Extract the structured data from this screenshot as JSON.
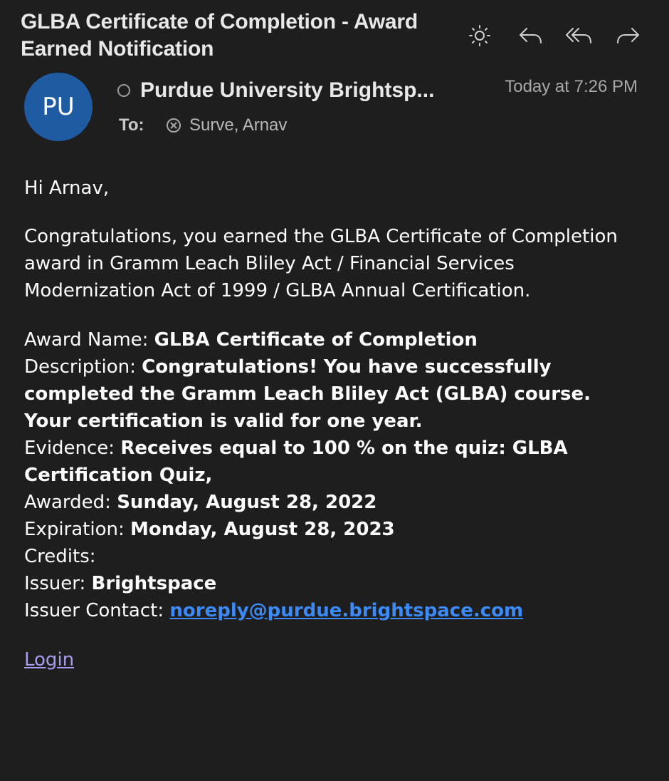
{
  "email": {
    "subject": "GLBA Certificate of Completion - Award Earned Notification",
    "avatar_initials": "PU",
    "sender": "Purdue University Brightsp...",
    "date": "Today at 7:26 PM",
    "to_label": "To:",
    "recipient": "Surve, Arnav"
  },
  "toolbar": {
    "icons": [
      "brightness-icon",
      "reply-icon",
      "reply-all-icon",
      "forward-icon"
    ]
  },
  "body": {
    "greeting": "Hi Arnav,",
    "para_lines": [
      "Congratulations, you earned the GLBA Certificate of Completion",
      "award in Gramm Leach Bliley Act / Financial Services",
      "Modernization Act of 1999 / GLBA Annual Certification."
    ],
    "award_name_label": "Award Name:",
    "award_name": "GLBA Certificate of Completion",
    "description_label": "Description:",
    "description_lines": [
      "Congratulations! You have successfully",
      "completed the Gramm Leach Bliley Act (GLBA) course.",
      "Your certification is valid for one year."
    ],
    "evidence_label": "Evidence:",
    "evidence_lines": [
      "Receives equal to 100 % on the quiz: GLBA",
      "Certification Quiz,"
    ],
    "awarded_label": "Awarded:",
    "awarded": "Sunday, August 28, 2022",
    "expiration_label": "Expiration:",
    "expiration": "Monday, August 28, 2023",
    "credits_label": "Credits:",
    "issuer_label": "Issuer:",
    "issuer": "Brightspace",
    "issuer_contact_label": "Issuer Contact:",
    "issuer_contact": "noreply@purdue.brightspace.com",
    "login_link": "Login"
  },
  "colors": {
    "background": "#1e1e1e",
    "avatar": "#1f5ba3",
    "link": "#3b8af5",
    "visited_link": "#a59cf0"
  }
}
